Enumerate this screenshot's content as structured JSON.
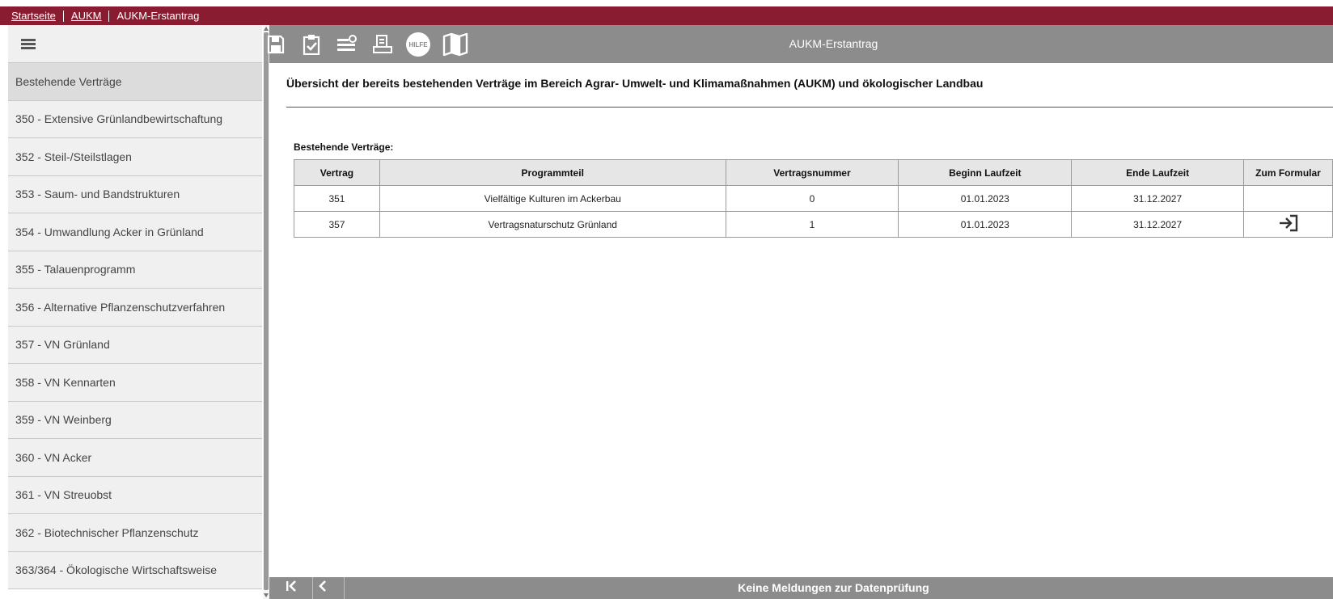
{
  "breadcrumb": {
    "items": [
      {
        "label": "Startseite",
        "link": true
      },
      {
        "label": "AUKM",
        "link": true
      },
      {
        "label": "AUKM-Erstantrag",
        "link": false
      }
    ]
  },
  "toolbar": {
    "title": "AUKM-Erstantrag",
    "help_label": "HILFE",
    "icons": [
      "save-icon",
      "clipboard-check-icon",
      "list-settings-icon",
      "print-icon",
      "help-icon",
      "map-icon"
    ]
  },
  "sidebar": {
    "items": [
      {
        "label": "Bestehende Verträge",
        "active": true
      },
      {
        "label": "350 - Extensive Grünlandbewirtschaftung"
      },
      {
        "label": "352 - Steil-/Steilstlagen"
      },
      {
        "label": "353 - Saum- und Bandstrukturen"
      },
      {
        "label": "354 - Umwandlung Acker in Grünland"
      },
      {
        "label": "355 - Talauenprogramm"
      },
      {
        "label": "356 - Alternative Pflanzenschutzverfahren"
      },
      {
        "label": "357 - VN Grünland"
      },
      {
        "label": "358 - VN Kennarten"
      },
      {
        "label": "359 - VN Weinberg"
      },
      {
        "label": "360 - VN Acker"
      },
      {
        "label": "361 - VN Streuobst"
      },
      {
        "label": "362 - Biotechnischer Pflanzenschutz"
      },
      {
        "label": "363/364 - Ökologische Wirtschaftsweise"
      }
    ]
  },
  "main": {
    "title": "Übersicht der bereits bestehenden Verträge im Bereich Agrar- Umwelt- und Klimamaßnahmen (AUKM) und ökologischer Landbau",
    "table_caption": "Bestehende Verträge:",
    "columns": [
      "Vertrag",
      "Programmteil",
      "Vertragsnummer",
      "Beginn Laufzeit",
      "Ende Laufzeit",
      "Zum Formular"
    ],
    "rows": [
      {
        "vertrag": "351",
        "programmteil": "Vielfältige Kulturen im Ackerbau",
        "vertragsnummer": "0",
        "beginn": "01.01.2023",
        "ende": "31.12.2027",
        "formular_link": false
      },
      {
        "vertrag": "357",
        "programmteil": "Vertragsnaturschutz Grünland",
        "vertragsnummer": "1",
        "beginn": "01.01.2023",
        "ende": "31.12.2027",
        "formular_link": true
      }
    ]
  },
  "footer": {
    "status": "Keine Meldungen zur Datenprüfung",
    "icons": [
      "first-page-icon",
      "previous-icon"
    ]
  },
  "colors": {
    "brand": "#8a1c31",
    "toolbar": "#8c8c8c",
    "sidebar_bg": "#f0f0f0"
  }
}
